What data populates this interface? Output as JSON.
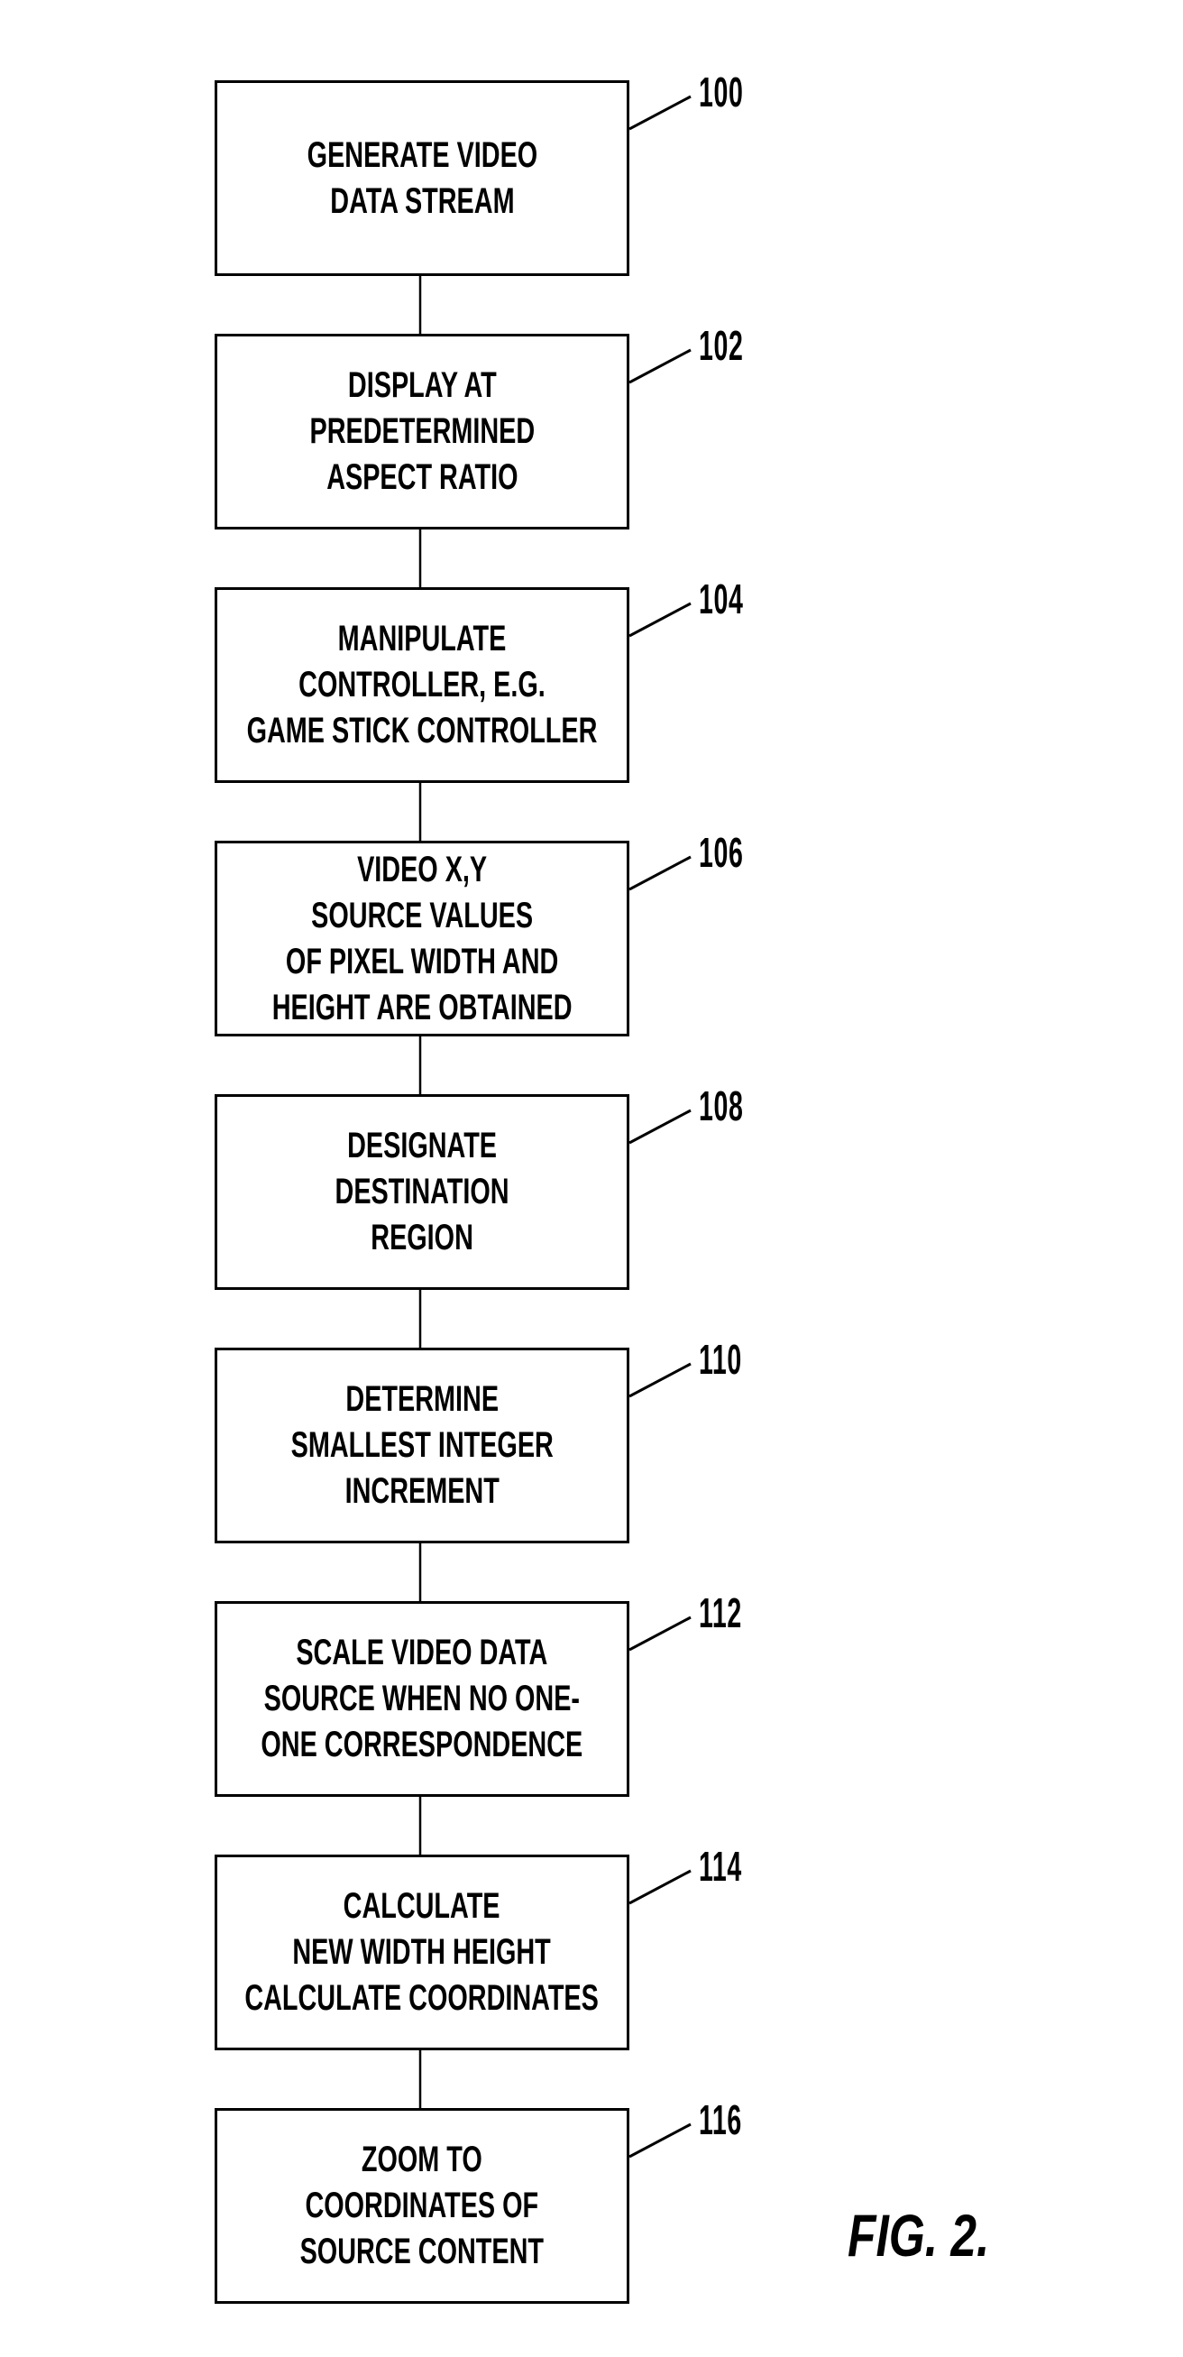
{
  "figure_label": "FIG. 2.",
  "steps": [
    {
      "ref": "100",
      "lines": [
        "GENERATE VIDEO",
        "DATA STREAM"
      ]
    },
    {
      "ref": "102",
      "lines": [
        "DISPLAY AT",
        "PREDETERMINED",
        "ASPECT RATIO"
      ]
    },
    {
      "ref": "104",
      "lines": [
        "MANIPULATE",
        "CONTROLLER, E.G.",
        "GAME STICK CONTROLLER"
      ]
    },
    {
      "ref": "106",
      "lines": [
        "VIDEO X,Y",
        "SOURCE VALUES",
        "OF PIXEL WIDTH AND",
        "HEIGHT ARE OBTAINED"
      ]
    },
    {
      "ref": "108",
      "lines": [
        "DESIGNATE",
        "DESTINATION",
        "REGION"
      ]
    },
    {
      "ref": "110",
      "lines": [
        "DETERMINE",
        "SMALLEST INTEGER",
        "INCREMENT"
      ]
    },
    {
      "ref": "112",
      "lines": [
        "SCALE VIDEO DATA",
        "SOURCE WHEN NO ONE-",
        "ONE CORRESPONDENCE"
      ]
    },
    {
      "ref": "114",
      "lines": [
        "CALCULATE",
        "NEW WIDTH HEIGHT",
        "CALCULATE COORDINATES"
      ]
    },
    {
      "ref": "116",
      "lines": [
        "ZOOM TO",
        "COORDINATES OF",
        "SOURCE CONTENT"
      ]
    }
  ]
}
